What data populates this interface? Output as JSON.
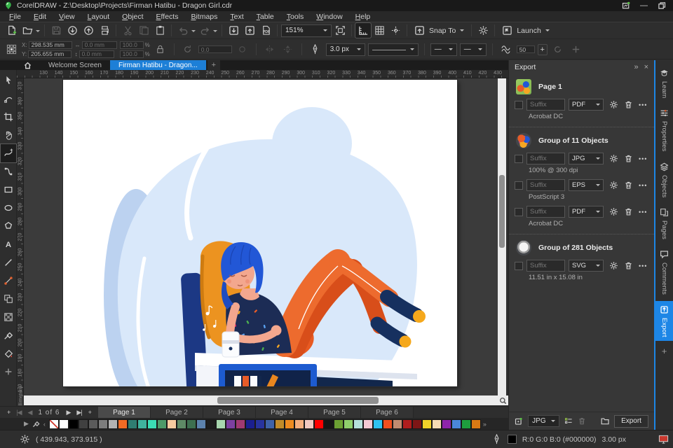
{
  "window": {
    "title": "CorelDRAW - Z:\\Desktop\\Projects\\Firman Hatibu - Dragon Girl.cdr"
  },
  "menu_items": [
    "File",
    "Edit",
    "View",
    "Layout",
    "Object",
    "Effects",
    "Bitmaps",
    "Text",
    "Table",
    "Tools",
    "Window",
    "Help"
  ],
  "toolbar": {
    "zoom_value": "151%",
    "snap_to_label": "Snap To",
    "launch_label": "Launch",
    "items": [
      {
        "icon": "new-doc"
      },
      {
        "icon": "open",
        "dropdown": true
      },
      {
        "sep": true
      },
      {
        "icon": "save",
        "disabled": true
      },
      {
        "icon": "import-circle"
      },
      {
        "icon": "export-circle"
      },
      {
        "icon": "print"
      },
      {
        "sep": true
      },
      {
        "icon": "cut",
        "disabled": true
      },
      {
        "icon": "copy",
        "disabled": true
      },
      {
        "icon": "paste"
      },
      {
        "sep": true
      },
      {
        "icon": "undo",
        "disabled": true,
        "dropdown": true
      },
      {
        "icon": "redo",
        "disabled": true,
        "dropdown": true
      },
      {
        "sep": true
      },
      {
        "icon": "import-box"
      },
      {
        "icon": "export-box"
      },
      {
        "icon": "pdf"
      },
      {
        "sep": true
      },
      {
        "zoombox": true
      },
      {
        "icon": "fullscreen"
      },
      {
        "sep": true
      },
      {
        "icon": "rulers",
        "active": true
      },
      {
        "icon": "grid"
      },
      {
        "icon": "guides"
      },
      {
        "sep": true
      },
      {
        "snapbox": true
      },
      {
        "sep": true
      },
      {
        "icon": "gear"
      },
      {
        "sep": true
      },
      {
        "launchbox": true
      }
    ]
  },
  "property_bar": {
    "x_label": "X:",
    "y_label": "Y:",
    "x_value": "298.535 mm",
    "y_value": "205.655 mm",
    "width_value": "0.0 mm",
    "height_value": "0.0 mm",
    "scale_x": "100.0",
    "scale_y": "100.0",
    "percent": "%",
    "rotation_value": "0.0",
    "outline_width": "3.0 px",
    "arrow_start": "—",
    "arrow_end": "—",
    "smoothing_value": "50"
  },
  "document_tabs": {
    "welcome": "Welcome Screen",
    "active_doc": "Firman Hatibu - Dragon...",
    "new_tab": "+"
  },
  "toolbox": {
    "active_tool": "freehand",
    "tools": [
      "pick",
      "shape",
      "crop",
      "pan",
      "freehand",
      "bezier",
      "rectangle",
      "ellipse",
      "polygon",
      "text",
      "line",
      "connector",
      "blend",
      "transparency",
      "eyedropper",
      "smart-fill",
      "more"
    ]
  },
  "rulers": {
    "h_labels": [
      130,
      140,
      150,
      160,
      170,
      180,
      190,
      200,
      210,
      220,
      230,
      240,
      250,
      260,
      270,
      280,
      290,
      300,
      310,
      320,
      330,
      340,
      350,
      360,
      370,
      380,
      390,
      400,
      410,
      420,
      430
    ],
    "v_labels": [
      370,
      360,
      350,
      340,
      330,
      320,
      310,
      300,
      290,
      280,
      270,
      260,
      250,
      240,
      230,
      220,
      210,
      200,
      190,
      180,
      170
    ],
    "units_label": "millimeters"
  },
  "export_panel": {
    "title": "Export",
    "suffix_placeholder": "Suffix",
    "groups": [
      {
        "name": "Page 1",
        "thumb": "t0",
        "rows": [
          {
            "format": "PDF",
            "detail": "Acrobat DC"
          }
        ]
      },
      {
        "name": "Group of 11 Objects",
        "thumb": "t1",
        "rows": [
          {
            "format": "JPG",
            "detail": "100% @ 300 dpi"
          },
          {
            "format": "EPS",
            "detail": "PostScript 3"
          },
          {
            "format": "PDF",
            "detail": "Acrobat DC"
          }
        ]
      },
      {
        "name": "Group of 281 Objects",
        "thumb": "t2",
        "rows": [
          {
            "format": "SVG",
            "detail": "11.51 in x 15.08 in"
          }
        ]
      }
    ],
    "footer_format": "JPG",
    "export_button": "Export"
  },
  "dock_tabs": [
    {
      "label": "Learn",
      "icon": "learn"
    },
    {
      "label": "Properties",
      "icon": "properties"
    },
    {
      "label": "Objects",
      "icon": "objects"
    },
    {
      "label": "Pages",
      "icon": "pages"
    },
    {
      "label": "Comments",
      "icon": "comments"
    },
    {
      "label": "Export",
      "icon": "export-tab",
      "active": true
    }
  ],
  "page_navigation": {
    "counter": "1 of 6",
    "pages": [
      "Page 1",
      "Page 2",
      "Page 3",
      "Page 4",
      "Page 5",
      "Page 6"
    ],
    "active_page": "Page 1"
  },
  "color_palette": [
    "none",
    "#FFFFFF",
    "#000000",
    "#404040",
    "#5B5B5B",
    "#7D7D7D",
    "#B3B3B3",
    "#F26B24",
    "#2F7D72",
    "#3FB39E",
    "#3BDDB4",
    "#4D9A69",
    "#F7CBA0",
    "#5E8A66",
    "#3D6F50",
    "#5C82AD",
    "#1D1D1D",
    "#A7D6AE",
    "#7C40A0",
    "#A03A72",
    "#1B1F8F",
    "#28349E",
    "#3F63A8",
    "#C18B29",
    "#EE8B20",
    "#F5AF7E",
    "#F1C9C1",
    "#FF0000",
    "#161616",
    "#6CA033",
    "#8FCF6C",
    "#B5E0DC",
    "#F3C9D4",
    "#30C2F0",
    "#F04F1F",
    "#C18B70",
    "#B01E1E",
    "#7E1616",
    "#F2D129",
    "#F7DCB4",
    "#8E24AA",
    "#4A86D9",
    "#1E9E3E",
    "#D97A14"
  ],
  "status_bar": {
    "coordinates": "( 439.943, 373.915 )",
    "color_info": "R:0 G:0 B:0 (#000000)",
    "outline_info": "3.00 px"
  },
  "colors": {
    "accent_blue": "#1D86E6",
    "tab_blue": "#1D7FD7",
    "pasteboard": "#3B3B3B"
  }
}
